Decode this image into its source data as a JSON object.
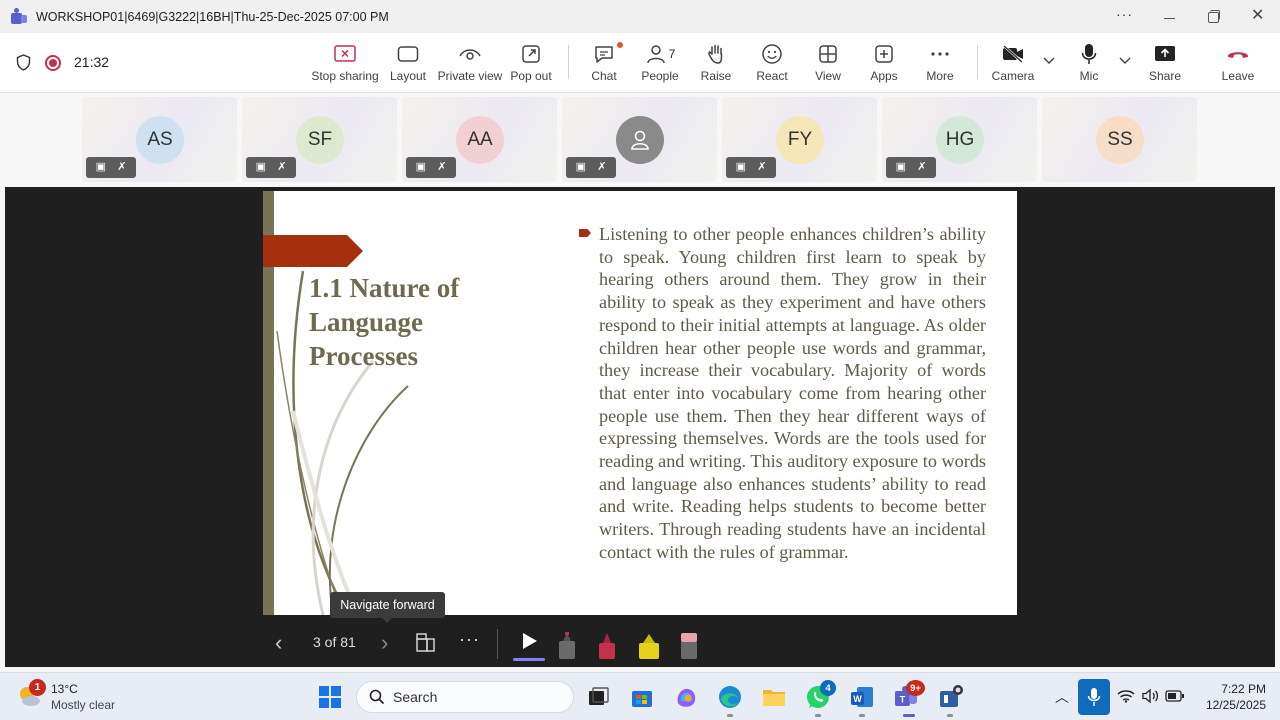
{
  "window": {
    "title": "WORKSHOP01|6469|G3222|16BH|Thu-25-Dec-2025 07:00 PM",
    "more": "···"
  },
  "meeting": {
    "timer": "21:32",
    "people_count": "7",
    "toolbar": [
      {
        "label": "Stop sharing",
        "icon": "stop-share-icon"
      },
      {
        "label": "Layout",
        "icon": "layout-icon"
      },
      {
        "label": "Private view",
        "icon": "eye-icon"
      },
      {
        "label": "Pop out",
        "icon": "pop-out-icon"
      },
      {
        "label": "Chat",
        "icon": "chat-icon"
      },
      {
        "label": "People",
        "icon": "people-icon"
      },
      {
        "label": "Raise",
        "icon": "hand-icon"
      },
      {
        "label": "React",
        "icon": "smile-icon"
      },
      {
        "label": "View",
        "icon": "grid-icon"
      },
      {
        "label": "Apps",
        "icon": "plus-icon"
      },
      {
        "label": "More",
        "icon": "more-icon"
      },
      {
        "label": "Camera",
        "icon": "camera-off-icon"
      },
      {
        "label": "Mic",
        "icon": "mic-icon"
      },
      {
        "label": "Share",
        "icon": "share-icon"
      },
      {
        "label": "Leave",
        "icon": "phone-hangup-icon"
      }
    ],
    "colors": {
      "record": "#c4314b",
      "leave": "#c4314b",
      "chat_badge": "#e3562b",
      "accent": "#5b5fc7"
    }
  },
  "participants": [
    {
      "initials": "AS",
      "color": "#cfe0f0",
      "muted": true
    },
    {
      "initials": "SF",
      "color": "#dde9cf",
      "muted": true
    },
    {
      "initials": "AA",
      "color": "#f2cfd2",
      "muted": true
    },
    {
      "initials": "",
      "color": "#8a8a8a",
      "muted": true,
      "icon": "person-icon"
    },
    {
      "initials": "FY",
      "color": "#f5e6b8",
      "muted": true
    },
    {
      "initials": "HG",
      "color": "#d3e8d8",
      "muted": true
    },
    {
      "initials": "SS",
      "color": "#f7dcc7",
      "muted": false
    }
  ],
  "slide": {
    "title_lines": [
      "1.1 Nature of",
      "Language",
      "Processes"
    ],
    "body": "Listening to other people enhances children’s ability to speak. Young children first learn to speak by hearing others around them. They grow in their ability to speak as they experiment and have others respond to their initial attempts at language. As older children hear other people use words and grammar, they increase their vocabulary. Majority of words that enter into vocabulary come from hearing other people use them. Then they hear different ways of expressing themselves. Words are the tools used for reading and writing. This auditory exposure to words and language also enhances students’ ability to read and write. Reading helps students to become better writers. Through reading students have an incidental contact with the rules of grammar.",
    "colors": {
      "accent": "#a5300f",
      "title": "#6f6a4f",
      "bar": "#7a7456"
    }
  },
  "presenter": {
    "tooltip": "Navigate forward",
    "page_indicator": "3 of 81",
    "prev": "‹",
    "next": "›",
    "more": "···"
  },
  "taskbar": {
    "weather_temp": "13°C",
    "weather_desc": "Mostly clear",
    "weather_badge": "1",
    "search_placeholder": "Search",
    "whatsapp_badge": "4",
    "teams_badge": "9+",
    "time": "7:22 PM",
    "date": "12/25/2025"
  }
}
